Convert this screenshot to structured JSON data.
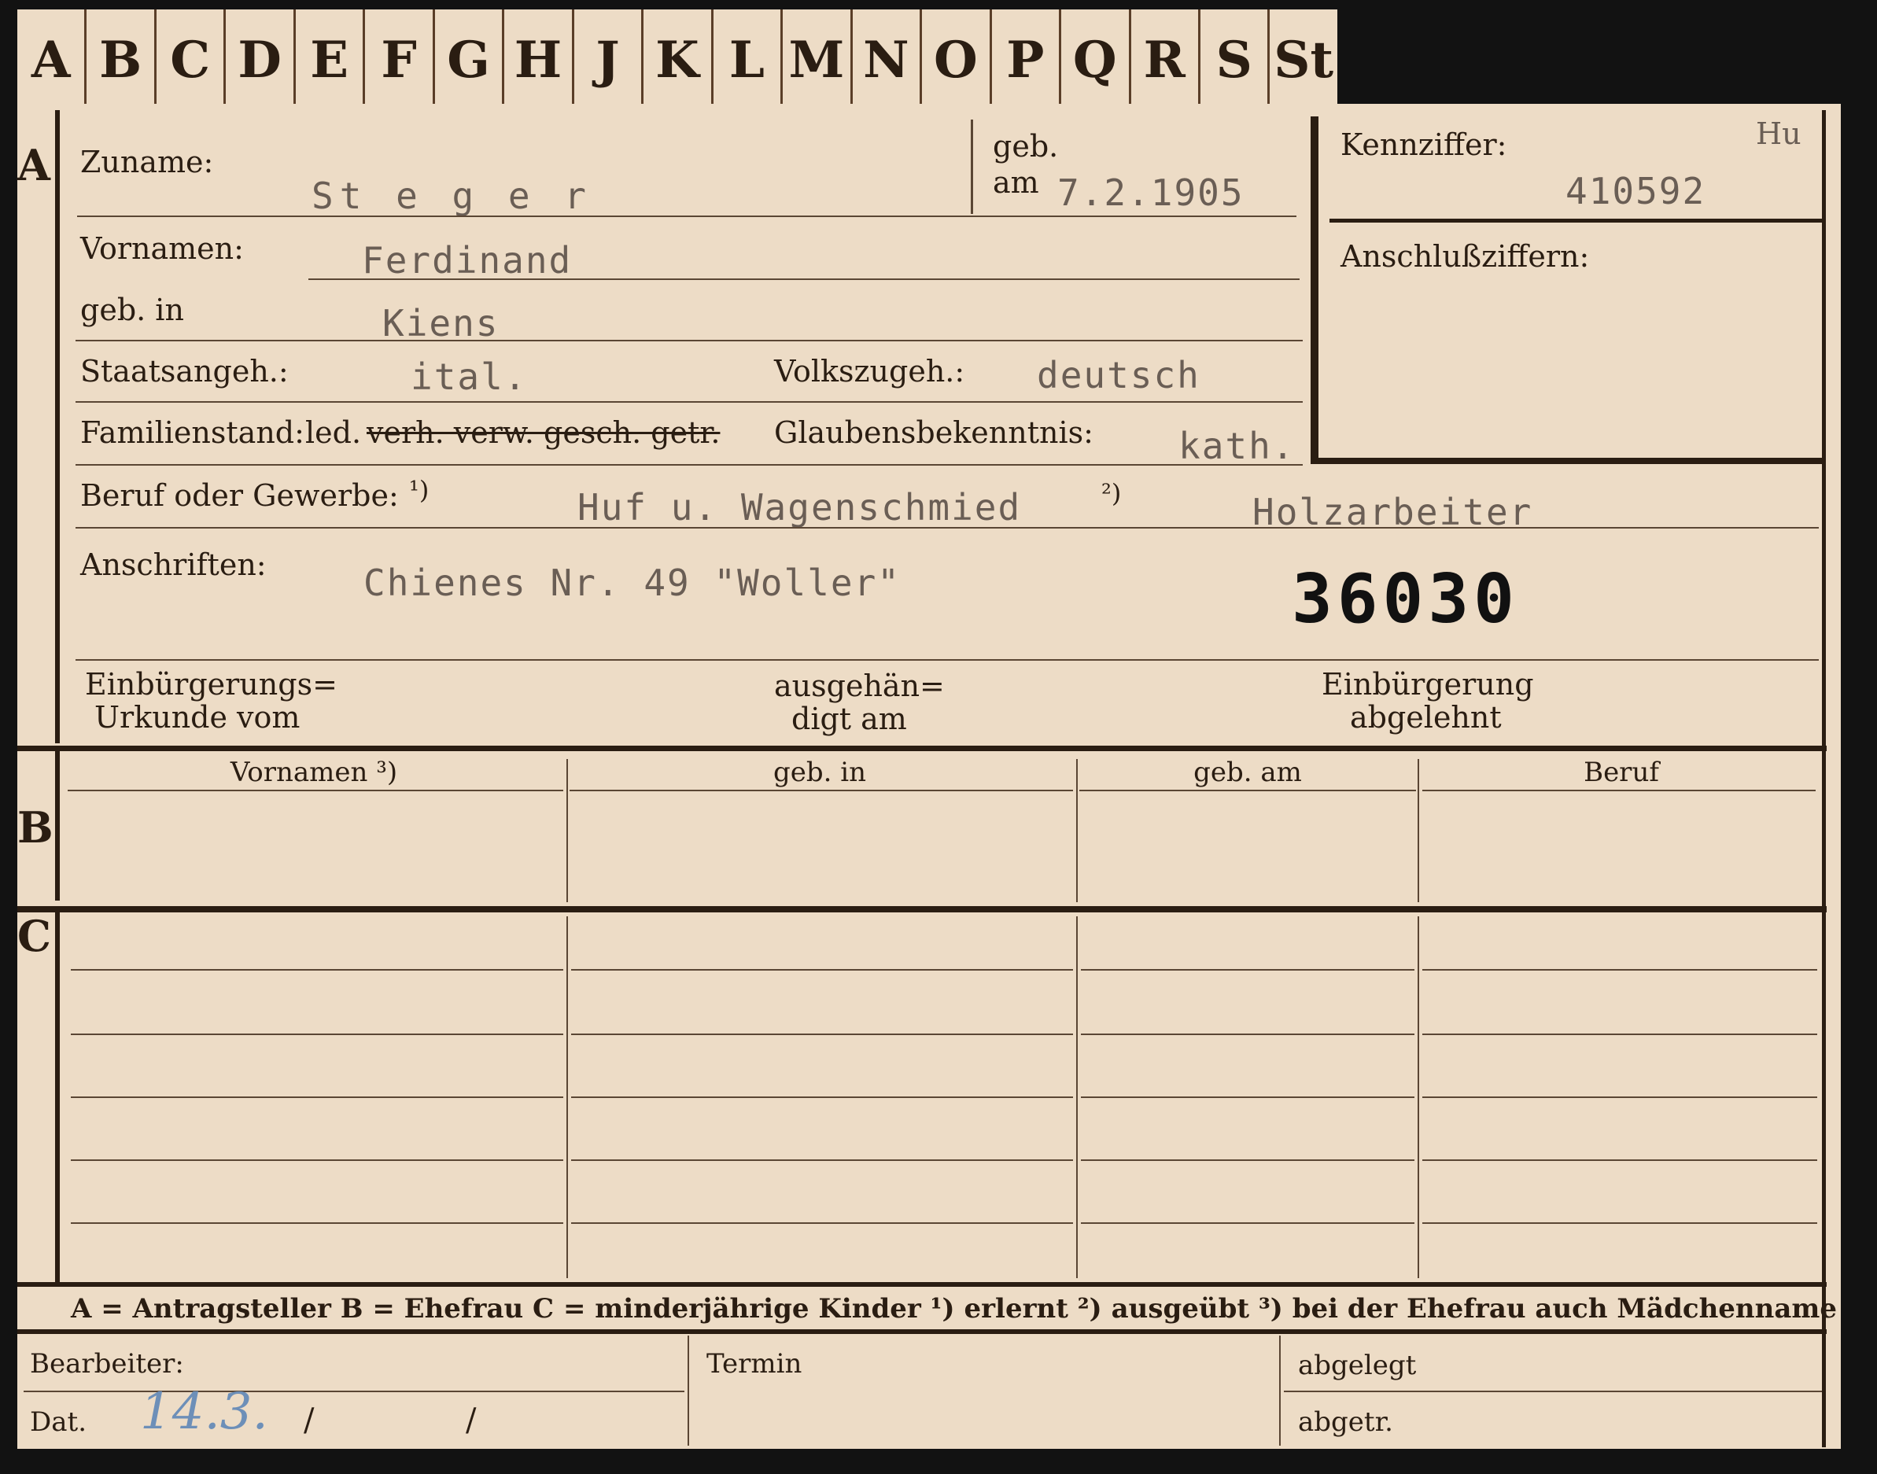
{
  "tabs": [
    "A",
    "B",
    "C",
    "D",
    "E",
    "F",
    "G",
    "H",
    "J",
    "K",
    "L",
    "M",
    "N",
    "O",
    "P",
    "Q",
    "R",
    "S",
    "St"
  ],
  "sections": {
    "a": "A",
    "b": "B",
    "c": "C"
  },
  "fields": {
    "zuname_label": "Zuname:",
    "zuname_value": "St e g e r",
    "geb_label": "geb.",
    "am_label": "am",
    "geb_am_value": "7.2.1905",
    "vornamen_label": "Vornamen:",
    "vornamen_value": "Ferdinand",
    "geb_in_label": "geb. in",
    "geb_in_value": "Kiens",
    "staats_label": "Staatsangeh.:",
    "staats_value": "ital.",
    "volks_label": "Volkszugeh.:",
    "volks_value": "deutsch",
    "familien_label": "Familienstand:",
    "familien_options_prefix": "led.",
    "familien_options_struck": "verh. verw. gesch. getr.",
    "glauben_label": "Glaubensbekenntnis:",
    "glauben_value": "kath.",
    "beruf_label": "Beruf oder Gewerbe:",
    "footnote1": "¹)",
    "beruf_value1": "Huf u. Wagenschmied",
    "footnote2": "²)",
    "beruf_value2": "Holzarbeiter",
    "anschriften_label": "Anschriften:",
    "anschriften_value": "Chienes Nr. 49 \"Woller\"",
    "big_number": "36030",
    "einb_urkunde_line1": "Einbürgerungs=",
    "einb_urkunde_line2": "Urkunde vom",
    "ausgehaen_line1": "ausgehän=",
    "ausgehaen_line2": "digt am",
    "einb_abgelehnt_line1": "Einbürgerung",
    "einb_abgelehnt_line2": "abgelehnt"
  },
  "right_box": {
    "kennziffer_label": "Kennziffer:",
    "hu": "Hu",
    "kennziffer_value": "410592",
    "anschluss_label": "Anschlußziffern:"
  },
  "table_headers": [
    "Vornamen ³)",
    "geb. in",
    "geb. am",
    "Beruf"
  ],
  "legend": "A = Antragsteller   B = Ehefrau   C = minderjährige Kinder   ¹) erlernt   ²) ausgeübt   ³) bei der Ehefrau auch Mädchenname",
  "bottom": {
    "bearbeiter_label": "Bearbeiter:",
    "termin_label": "Termin",
    "abgelegt_label": "abgelegt",
    "dat_label": "Dat.",
    "dat_value": "14.3.",
    "slash1": "/",
    "slash2": "/",
    "abgetr_label": "abgetr."
  },
  "colors": {
    "paper": "#eddcc6",
    "ink": "#2a1d12",
    "typewriter": "#6a5e55",
    "pen": "#6d8fb8",
    "background": "#121212"
  }
}
